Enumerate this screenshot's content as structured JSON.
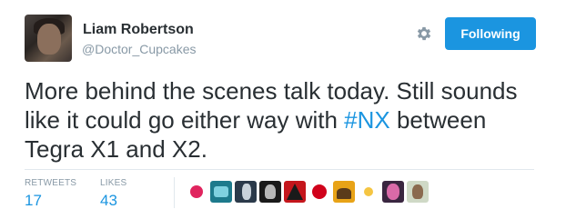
{
  "author": {
    "name": "Liam Robertson",
    "handle": "@Doctor_Cupcakes"
  },
  "follow_button": {
    "label": "Following"
  },
  "tweet": {
    "text_before": "More behind the scenes talk today. Still sounds like it could go either way with ",
    "hashtag": "#NX",
    "text_after": " between Tegra X1 and X2."
  },
  "stats": {
    "retweets": {
      "label": "RETWEETS",
      "count": "17"
    },
    "likes": {
      "label": "LIKES",
      "count": "43"
    }
  },
  "likers": [
    {
      "name": "liker-avatar-1",
      "color": "#ffffff",
      "accent": "#e0245e"
    },
    {
      "name": "liker-avatar-2",
      "color": "#1d7a8c",
      "accent": "#7fd1e0"
    },
    {
      "name": "liker-avatar-3",
      "color": "#2b3a4a",
      "accent": "#c9d2da"
    },
    {
      "name": "liker-avatar-4",
      "color": "#1a1a1a",
      "accent": "#b8b8b8"
    },
    {
      "name": "liker-avatar-5",
      "color": "#c4161c",
      "accent": "#1a1a1a"
    },
    {
      "name": "liker-avatar-6",
      "color": "#ffffff",
      "accent": "#d0021b"
    },
    {
      "name": "liker-avatar-7",
      "color": "#e8a317",
      "accent": "#5a3b1a"
    },
    {
      "name": "liker-avatar-8",
      "color": "#ffffff",
      "accent": "#f5c542"
    },
    {
      "name": "liker-avatar-9",
      "color": "#3a2640",
      "accent": "#d96aa8"
    },
    {
      "name": "liker-avatar-10",
      "color": "#cfd9c6",
      "accent": "#8a6a4f"
    }
  ],
  "colors": {
    "accent": "#1b95e0",
    "text": "#292f33",
    "muted": "#8899a6",
    "divider": "#e1e8ed"
  },
  "icons": {
    "settings": "gear-icon"
  }
}
